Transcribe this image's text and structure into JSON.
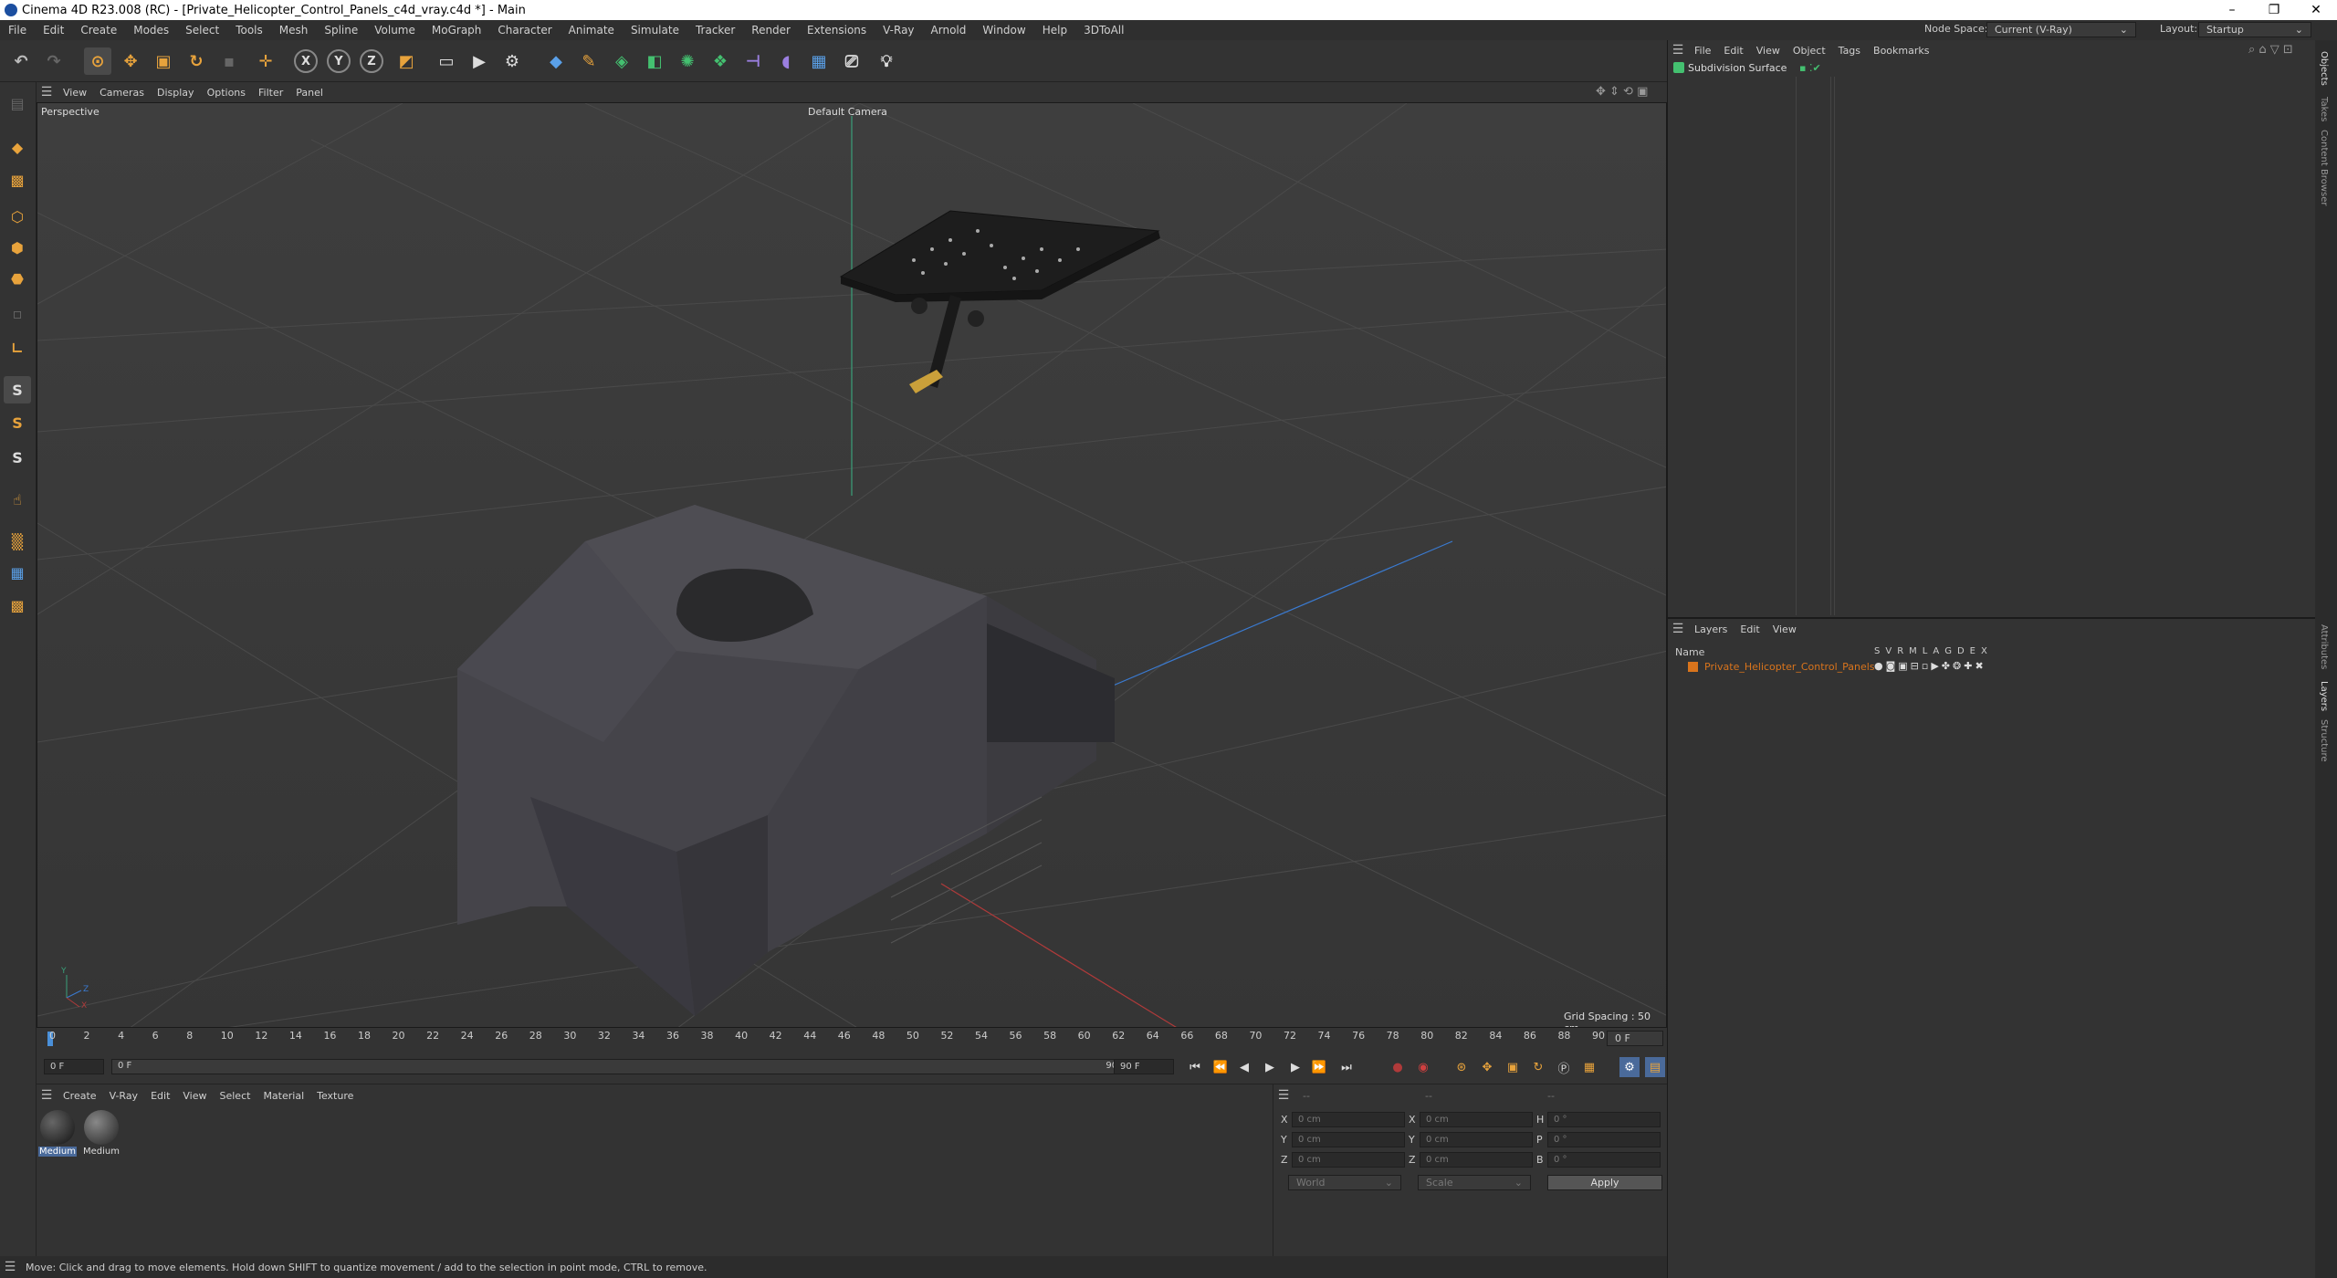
{
  "window": {
    "title": "Cinema 4D R23.008 (RC) - [Private_Helicopter_Control_Panels_c4d_vray.c4d *] - Main",
    "minimize": "–",
    "maximize": "❐",
    "close": "✕"
  },
  "menubar": {
    "items": [
      "File",
      "Edit",
      "Create",
      "Modes",
      "Select",
      "Tools",
      "Mesh",
      "Spline",
      "Volume",
      "MoGraph",
      "Character",
      "Animate",
      "Simulate",
      "Tracker",
      "Render",
      "Extensions",
      "V-Ray",
      "Arnold",
      "Window",
      "Help",
      "3DToAll"
    ],
    "node_space_label": "Node Space:",
    "node_space_value": "Current (V-Ray)",
    "layout_label": "Layout:",
    "layout_value": "Startup"
  },
  "viewport": {
    "menu": [
      "View",
      "Cameras",
      "Display",
      "Options",
      "Filter",
      "Panel"
    ],
    "label": "Perspective",
    "camera": "Default Camera",
    "grid_spacing": "Grid Spacing : 50 cm",
    "axis_y": "Y",
    "axis_z": "Z",
    "axis_x": "X"
  },
  "timeline": {
    "ticks": [
      "0",
      "2",
      "4",
      "6",
      "8",
      "10",
      "12",
      "14",
      "16",
      "18",
      "20",
      "22",
      "24",
      "26",
      "28",
      "30",
      "32",
      "34",
      "36",
      "38",
      "40",
      "42",
      "44",
      "46",
      "48",
      "50",
      "52",
      "54",
      "56",
      "58",
      "60",
      "62",
      "64",
      "66",
      "68",
      "70",
      "72",
      "74",
      "76",
      "78",
      "80",
      "82",
      "84",
      "86",
      "88",
      "90"
    ],
    "current_frame": "0 F",
    "start": "0 F",
    "range_start": "0 F",
    "range_end": "90 F",
    "end": "90 F"
  },
  "materials": {
    "menu": [
      "Create",
      "V-Ray",
      "Edit",
      "View",
      "Select",
      "Material",
      "Texture"
    ],
    "items": [
      "Medium",
      "Medium"
    ]
  },
  "coords": {
    "header1": "--",
    "header2": "--",
    "header3": "--",
    "rows": [
      {
        "a": "X",
        "av": "0 cm",
        "b": "X",
        "bv": "0 cm",
        "c": "H",
        "cv": "0 °"
      },
      {
        "a": "Y",
        "av": "0 cm",
        "b": "Y",
        "bv": "0 cm",
        "c": "P",
        "cv": "0 °"
      },
      {
        "a": "Z",
        "av": "0 cm",
        "b": "Z",
        "bv": "0 cm",
        "c": "B",
        "cv": "0 °"
      }
    ],
    "world": "World",
    "scale": "Scale",
    "apply": "Apply"
  },
  "status": "Move: Click and drag to move elements. Hold down SHIFT to quantize movement / add to the selection in point mode, CTRL to remove.",
  "objects": {
    "menu": [
      "File",
      "Edit",
      "View",
      "Object",
      "Tags",
      "Bookmarks"
    ],
    "item": "Subdivision Surface"
  },
  "layers": {
    "menu": [
      "Layers",
      "Edit",
      "View"
    ],
    "col_name": "Name",
    "cols": [
      "S",
      "V",
      "R",
      "M",
      "L",
      "A",
      "G",
      "D",
      "E",
      "X"
    ],
    "item": "Private_Helicopter_Control_Panels",
    "item_color": "#d9741c"
  },
  "side_tabs": [
    "Objects",
    "Takes",
    "Content Browser",
    "Attributes",
    "Layers",
    "Structure"
  ],
  "accent": "#4a90d9"
}
